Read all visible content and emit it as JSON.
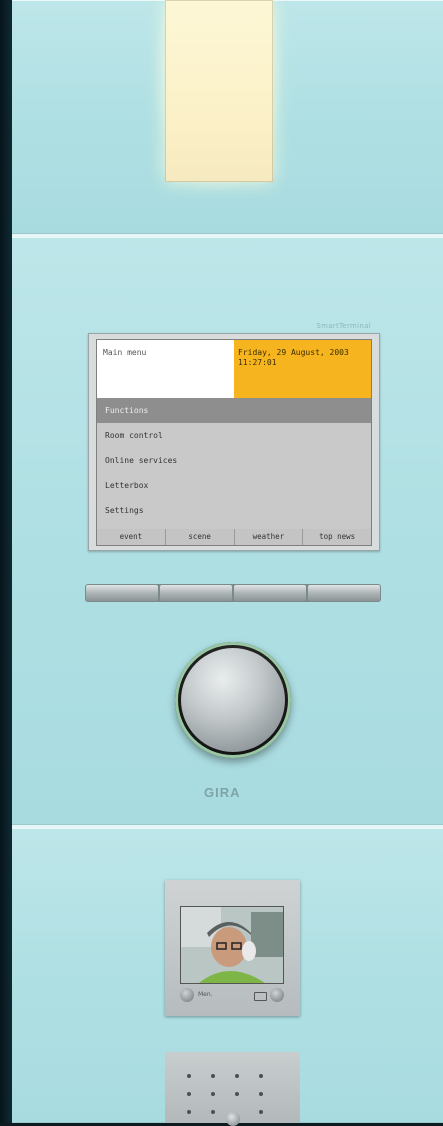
{
  "display": {
    "brand_small": "SmartTerminal",
    "title": "Main menu",
    "date": "Friday, 29 August, 2003",
    "time": "11:27:01",
    "menu": [
      {
        "label": "Functions",
        "selected": true
      },
      {
        "label": "Room control",
        "selected": false
      },
      {
        "label": "Online services",
        "selected": false
      },
      {
        "label": "Letterbox",
        "selected": false
      },
      {
        "label": "Settings",
        "selected": false
      }
    ],
    "softkeys": [
      "event",
      "scene",
      "weather",
      "top news"
    ]
  },
  "brand": "GIRA",
  "video": {
    "left_label": "Men."
  },
  "colors": {
    "panel": "#b3e1e5",
    "header_highlight": "#f6b51e",
    "selected_row": "#8e8e8e"
  }
}
